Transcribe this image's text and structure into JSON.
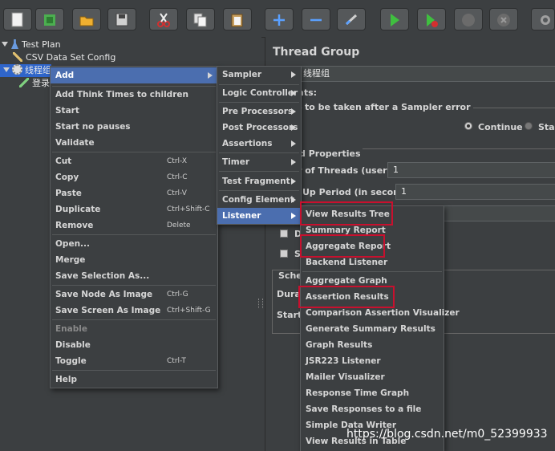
{
  "toolbar": {
    "icons": [
      "new-icon",
      "templates-icon",
      "open-icon",
      "save-icon",
      "cut-icon",
      "copy-icon",
      "paste-icon",
      "expand-icon",
      "collapse-icon",
      "toggle-icon",
      "start-icon",
      "start-no-pause-icon",
      "stop-icon",
      "shutdown-icon",
      "clear-icon"
    ]
  },
  "tree": {
    "test_plan": "Test Plan",
    "csv_config": "CSV Data Set Config",
    "thread_group": "线程组",
    "login": "登录"
  },
  "panel": {
    "title": "Thread Group",
    "name_value": "线程组",
    "comments_label": "nts:",
    "error_action_label": "to be taken after a Sampler error",
    "continue_label": "Continue",
    "start_label": "Star",
    "props_label": "d Properties",
    "threads_label": "r of Threads (users):",
    "threads_value": "1",
    "rampup_label": "Up Period (in seconds):",
    "rampup_value": "1",
    "d_label": "D",
    "s_label": "S",
    "sched_label": "Sche",
    "duration_label": "Durat",
    "startup_label": "Startu"
  },
  "context_menu": {
    "items": [
      {
        "label": "Add",
        "shortcut": ""
      },
      {
        "label": "Add Think Times to children",
        "shortcut": ""
      },
      {
        "label": "Start",
        "shortcut": ""
      },
      {
        "label": "Start no pauses",
        "shortcut": ""
      },
      {
        "label": "Validate",
        "shortcut": ""
      },
      {
        "label": "Cut",
        "shortcut": "Ctrl-X"
      },
      {
        "label": "Copy",
        "shortcut": "Ctrl-C"
      },
      {
        "label": "Paste",
        "shortcut": "Ctrl-V"
      },
      {
        "label": "Duplicate",
        "shortcut": "Ctrl+Shift-C"
      },
      {
        "label": "Remove",
        "shortcut": "Delete"
      },
      {
        "label": "Open...",
        "shortcut": ""
      },
      {
        "label": "Merge",
        "shortcut": ""
      },
      {
        "label": "Save Selection As...",
        "shortcut": ""
      },
      {
        "label": "Save Node As Image",
        "shortcut": "Ctrl-G"
      },
      {
        "label": "Save Screen As Image",
        "shortcut": "Ctrl+Shift-G"
      },
      {
        "label": "Enable",
        "shortcut": ""
      },
      {
        "label": "Disable",
        "shortcut": ""
      },
      {
        "label": "Toggle",
        "shortcut": "Ctrl-T"
      },
      {
        "label": "Help",
        "shortcut": ""
      }
    ]
  },
  "add_menu": {
    "items": [
      {
        "label": "Sampler"
      },
      {
        "label": "Logic Controller"
      },
      {
        "label": "Pre Processors"
      },
      {
        "label": "Post Processors"
      },
      {
        "label": "Assertions"
      },
      {
        "label": "Timer"
      },
      {
        "label": "Test Fragment"
      },
      {
        "label": "Config Element"
      },
      {
        "label": "Listener"
      }
    ]
  },
  "listener_menu": {
    "items": [
      {
        "label": "View Results Tree"
      },
      {
        "label": "Summary Report"
      },
      {
        "label": "Aggregate Report"
      },
      {
        "label": "Backend Listener"
      },
      {
        "label": "Aggregate Graph"
      },
      {
        "label": "Assertion Results"
      },
      {
        "label": "Comparison Assertion Visualizer"
      },
      {
        "label": "Generate Summary Results"
      },
      {
        "label": "Graph Results"
      },
      {
        "label": "JSR223 Listener"
      },
      {
        "label": "Mailer Visualizer"
      },
      {
        "label": "Response Time Graph"
      },
      {
        "label": "Save Responses to a file"
      },
      {
        "label": "Simple Data Writer"
      },
      {
        "label": "View Results in Table"
      }
    ]
  },
  "watermark": "https://blog.csdn.net/m0_52399933",
  "colors": {
    "selection": "#4b6eaf",
    "highlight": "#c8102e",
    "background": "#3c3f41"
  }
}
